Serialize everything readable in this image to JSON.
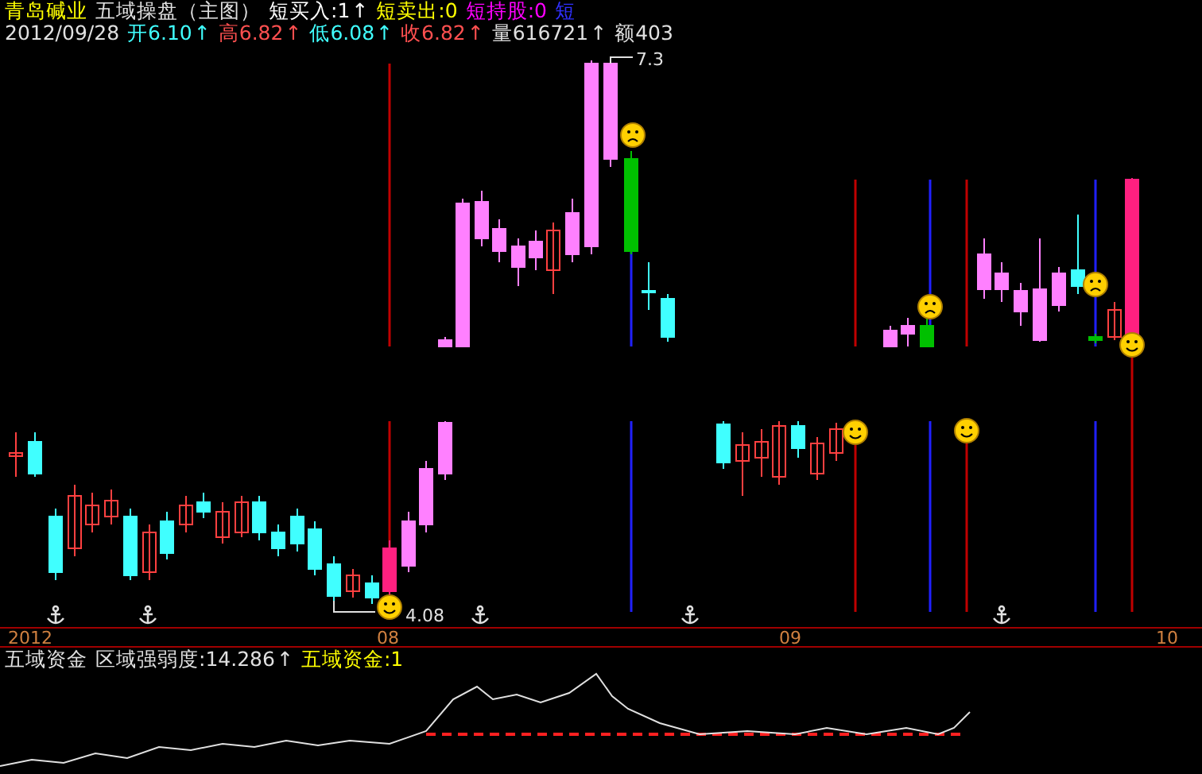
{
  "header": {
    "stock_name": "青岛碱业",
    "indicator_name": "五域操盘（主图）",
    "signals": [
      {
        "label": "短买入:1",
        "arrow": "↑",
        "color": "#ffffff"
      },
      {
        "label": "短卖出:0",
        "color": "#ffff00"
      },
      {
        "label": "短持股:0",
        "color": "#ff00ff"
      },
      {
        "label": "短",
        "color": "#3030ff"
      }
    ],
    "date": "2012/09/28",
    "quotes": [
      {
        "label": "开6.10",
        "arrow": "↑",
        "color": "#40ffff"
      },
      {
        "label": "高6.82",
        "arrow": "↑",
        "color": "#ff5050"
      },
      {
        "label": "低6.08",
        "arrow": "↑",
        "color": "#40ffff"
      },
      {
        "label": "收6.82",
        "arrow": "↑",
        "color": "#ff5050"
      },
      {
        "label": "量616721",
        "arrow": "↑",
        "color": "#e0e0e0"
      },
      {
        "label": "额403",
        "color": "#e0e0e0"
      }
    ]
  },
  "chart": {
    "high_label": "7.3",
    "low_label": "4.08",
    "x_axis_labels": [
      "2012",
      "08",
      "09",
      "10"
    ]
  },
  "indicator": {
    "name": "五域资金",
    "values": [
      {
        "label": "区域强弱度:14.286",
        "arrow": "↑",
        "color": "#e0e0e0"
      },
      {
        "label": "五域资金:1",
        "color": "#ffff00"
      }
    ]
  }
}
